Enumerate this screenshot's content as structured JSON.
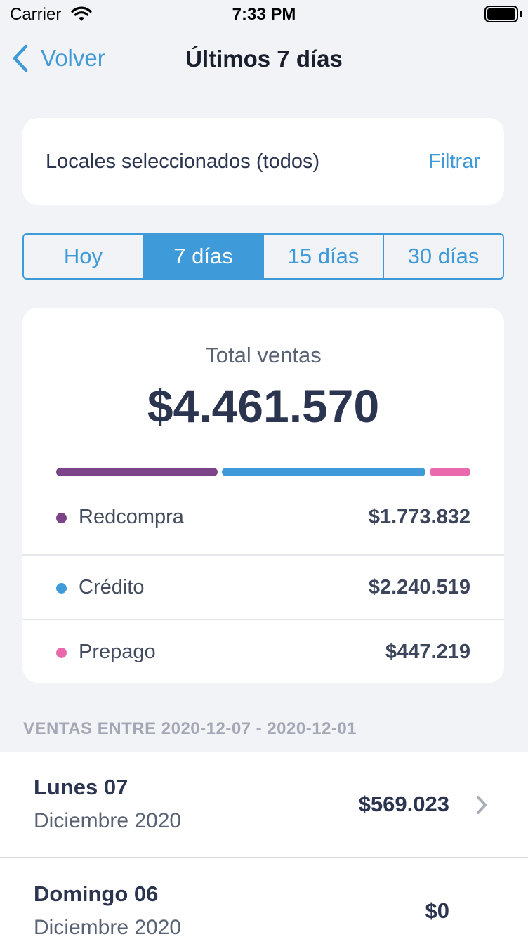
{
  "status_bar": {
    "carrier": "Carrier",
    "time": "7:33 PM"
  },
  "nav": {
    "back_label": "Volver",
    "title": "Últimos 7 días"
  },
  "locales": {
    "label": "Locales seleccionados (todos)",
    "filter_label": "Filtrar"
  },
  "segments": [
    {
      "label": "Hoy",
      "active": false
    },
    {
      "label": "7 días",
      "active": true
    },
    {
      "label": "15 días",
      "active": false
    },
    {
      "label": "30 días",
      "active": false
    }
  ],
  "total": {
    "label": "Total ventas",
    "value": "$4.461.570",
    "breakdown": [
      {
        "name": "Redcompra",
        "amount": "$1.773.832",
        "value": 1773832,
        "color": "#7b4388"
      },
      {
        "name": "Crédito",
        "amount": "$2.240.519",
        "value": 2240519,
        "color": "#3e9ad8"
      },
      {
        "name": "Prepago",
        "amount": "$447.219",
        "value": 447219,
        "color": "#e86aad"
      }
    ]
  },
  "section_header": "VENTAS ENTRE 2020-12-07 - 2020-12-01",
  "days": [
    {
      "day": "Lunes 07",
      "month": "Diciembre 2020",
      "amount": "$569.023",
      "has_chevron": true
    },
    {
      "day": "Domingo 06",
      "month": "Diciembre 2020",
      "amount": "$0",
      "has_chevron": false
    }
  ]
}
